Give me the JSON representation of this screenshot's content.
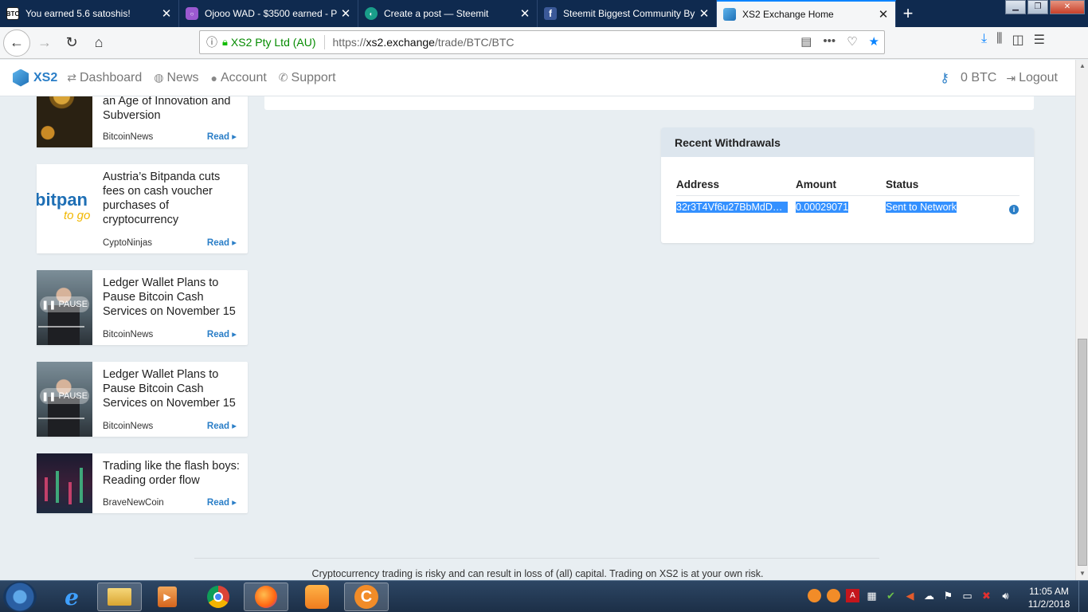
{
  "tabs": [
    {
      "title": "You earned 5.6 satoshis!",
      "icon_text": "BTC",
      "icon_color": "#ffffff",
      "icon_fg": "#111111"
    },
    {
      "title": "Ojooo WAD - $3500 earned - P",
      "icon_text": "",
      "icon_color": "#9b59d0",
      "icon_fg": "#ffffff"
    },
    {
      "title": "Create a post — Steemit",
      "icon_text": "",
      "icon_color": "#1a9e8a",
      "icon_fg": "#ffffff"
    },
    {
      "title": "Steemit Biggest Community By",
      "icon_text": "f",
      "icon_color": "#3b5998",
      "icon_fg": "#ffffff"
    },
    {
      "title": "XS2 Exchange Home",
      "icon_text": "",
      "icon_color": "#4a9de0",
      "icon_fg": "#ffffff"
    }
  ],
  "urlbar": {
    "site_identity": "XS2 Pty Ltd (AU)",
    "url_scheme": "https://",
    "url_host": "xs2.exchange",
    "url_path": "/trade/BTC/BTC"
  },
  "site_nav": {
    "logo": "XS2",
    "items": [
      "Dashboard",
      "News",
      "Account",
      "Support"
    ],
    "balance": "0 BTC",
    "logout": "Logout"
  },
  "news": [
    {
      "title": "an Age of Innovation and Subversion",
      "source": "BitcoinNews",
      "read": "Read"
    },
    {
      "title": "Austria’s Bitpanda cuts fees on cash voucher purchases of cryptocurrency",
      "source": "CyptoNinjas",
      "read": "Read",
      "thumb_text_1": "bitpan",
      "thumb_text_2": "to go"
    },
    {
      "title": "Ledger Wallet Plans to Pause Bitcoin Cash Services on November 15",
      "source": "BitcoinNews",
      "read": "Read",
      "thumb_text_1": "PAUSE"
    },
    {
      "title": "Ledger Wallet Plans to Pause Bitcoin Cash Services on November 15",
      "source": "BitcoinNews",
      "read": "Read",
      "thumb_text_1": "PAUSE"
    },
    {
      "title": "Trading like the flash boys: Reading order flow",
      "source": "BraveNewCoin",
      "read": "Read"
    }
  ],
  "withdrawals": {
    "title": "Recent Withdrawals",
    "columns": [
      "Address",
      "Amount",
      "Status"
    ],
    "rows": [
      {
        "address": "32r3T4Vf6u27BbMdDa…",
        "amount": "0.00029071",
        "status": "Sent to Network"
      }
    ]
  },
  "footer": "Cryptocurrency trading is risky and can result in loss of (all) capital. Trading on XS2 is at your own risk.",
  "taskbar": {
    "time": "11:05 AM",
    "date": "11/2/2018"
  },
  "colors": {
    "accent": "#2a7ec7",
    "selection": "#3390ff",
    "page_bg": "#e8eef2"
  }
}
